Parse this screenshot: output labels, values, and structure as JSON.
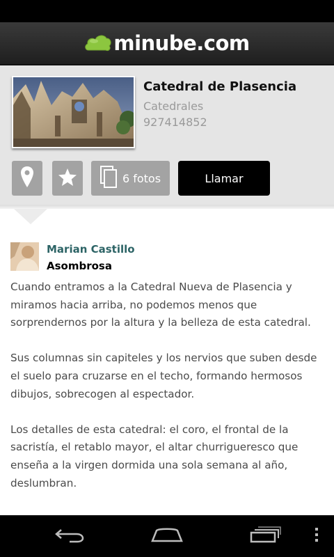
{
  "header": {
    "logo_text": "minube.com",
    "brand_green": "#8cc63f"
  },
  "place": {
    "title": "Catedral de Plasencia",
    "category": "Catedrales",
    "phone": "927414852",
    "photo_icon": "cathedral-photo"
  },
  "actions": {
    "map_icon": "map-pin-icon",
    "favorite_icon": "star-icon",
    "photos_label": "6 fotos",
    "photos_icon": "photos-stack-icon",
    "call_label": "Llamar"
  },
  "review": {
    "author": "Marian Castillo",
    "title": "Asombrosa",
    "paragraphs": [
      "Cuando entramos a la Catedral Nueva de Plasencia y miramos hacia arriba, no podemos menos que sorprendernos por la altura y la belleza de esta catedral.",
      "Sus columnas sin capiteles y los nervios que suben desde el suelo para cruzarse en el techo, formando hermosos dibujos, sobrecogen al espectador.",
      "Los detalles de esta catedral: el coro, el frontal de la sacristía, el retablo mayor, el altar churrigueresco que enseña a la virgen dormida una sola semana al año, deslumbran."
    ]
  },
  "system_nav": {
    "back_icon": "back-icon",
    "home_icon": "home-icon",
    "recents_icon": "recent-apps-icon",
    "menu_icon": "overflow-menu-icon"
  }
}
